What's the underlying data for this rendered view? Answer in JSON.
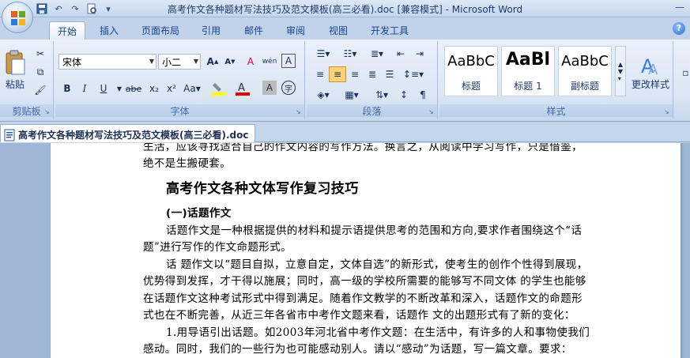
{
  "window": {
    "title": "高考作文各种题材写法技巧及范文模板(高三必看).doc [兼容模式] - Microsoft Word"
  },
  "tabs": [
    {
      "label": "开始",
      "active": true
    },
    {
      "label": "插入"
    },
    {
      "label": "页面布局"
    },
    {
      "label": "引用"
    },
    {
      "label": "邮件"
    },
    {
      "label": "审阅"
    },
    {
      "label": "视图"
    },
    {
      "label": "开发工具"
    }
  ],
  "ribbon": {
    "clipboard": {
      "paste_label": "粘贴",
      "group_label": "剪贴板"
    },
    "font": {
      "font_name": "宋体",
      "font_size": "小二",
      "group_label": "字体",
      "bold": "B",
      "italic": "I",
      "underline": "U",
      "strike": "abe",
      "subscript": "x₂",
      "superscript": "x²",
      "case": "Aa",
      "grow": "A",
      "shrink": "A",
      "clear": "A",
      "phonetic": "wén",
      "border_char": "A",
      "shade_char": "A",
      "enclose": "字"
    },
    "paragraph": {
      "group_label": "段落"
    },
    "styles": {
      "group_label": "样式",
      "items": [
        {
          "sample": "AaBbC",
          "name": "标题"
        },
        {
          "sample": "AaBl",
          "name": "标题 1"
        },
        {
          "sample": "AaBbC",
          "name": "副标题"
        }
      ],
      "change_styles": "更改样式"
    }
  },
  "document": {
    "tab_name": "高考作文各种题材写法技巧及范文模板(高三必看).doc",
    "lines": {
      "l0": "生活，应该寻找适合自己的作文内容的写作方法。换言之，从阅读中学习写作，只是借鉴，",
      "l1": "绝不是生搬硬套。",
      "heading": "高考作文各种文体写作复习技巧",
      "subhead": "(一)话题作文",
      "p1a": "话题作文是一种根据提供的材料和提示语提供思考的范围和方向,要求作者围绕这个“话",
      "p1b": "题”进行写作的作文命题形式。",
      "p2a": "话  题作文以“题目自拟，立意自定，文体自选”的新形式，使考生的创作个性得到展现，",
      "p2b": "优势得到发挥，才干得以施展；同时，高一级的学校所需要的能够写不同文体  的学生也能够",
      "p2c": "在话题作文这种考试形式中得到满足。随着作文教学的不断改革和深入，话题作文的命题形",
      "p2d": "式也在不断完善，从近三年各省市中考作文题来看，话题作  文的出题形式有了新的变化：",
      "p3a": "1.用导语引出话题。如2003年河北省中考作文题：在生活中，有许多的人和事物使我们",
      "p3b": "感动。同时，我们的一些行为也可能感动别人。请以“感动”为话题，写一篇文章。要求："
    }
  }
}
